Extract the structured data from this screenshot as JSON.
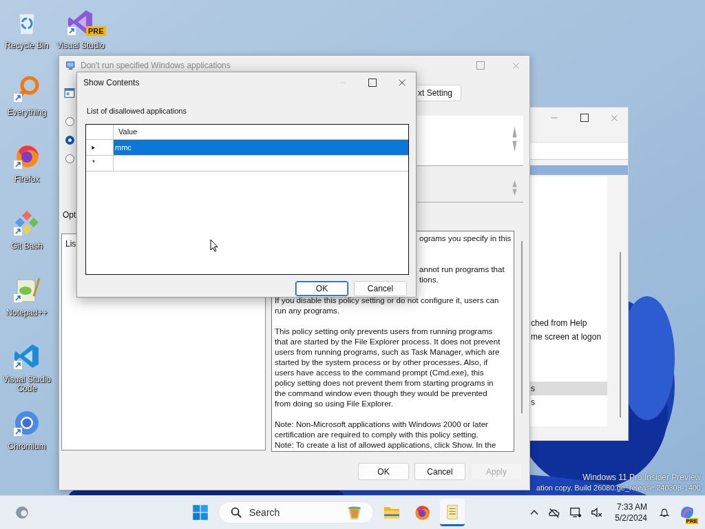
{
  "desktop_icons": [
    {
      "kind": "recycle",
      "label": "Recycle Bin",
      "shortcut": false
    },
    {
      "kind": "everything",
      "label": "Everything",
      "shortcut": true
    },
    {
      "kind": "firefox",
      "label": "Firefox",
      "shortcut": true
    },
    {
      "kind": "gitbash",
      "label": "Git Bash",
      "shortcut": true
    },
    {
      "kind": "notepadpp",
      "label": "Notepad++",
      "shortcut": true
    },
    {
      "kind": "vscode",
      "label": "Visual Studio Code",
      "shortcut": true
    },
    {
      "kind": "chromium",
      "label": "Chromium",
      "shortcut": true
    }
  ],
  "desktop_icon_2": {
    "kind": "vs",
    "label": "Visual Studio",
    "badge": "PRE",
    "shortcut": true
  },
  "back_window": {
    "items": [
      {
        "text": "ched from Help",
        "selected": false
      },
      {
        "text": "me screen at logon",
        "selected": false
      },
      {
        "text": "s",
        "selected": true
      },
      {
        "text": "s",
        "selected": false
      }
    ]
  },
  "policy_window": {
    "title": "Don't run specified Windows applications",
    "next_button": "xt Setting",
    "radios": [
      {
        "selected": false
      },
      {
        "selected": true
      },
      {
        "selected": false
      }
    ],
    "options_label": "Opt",
    "list_label": "Lis",
    "help": [
      {
        "kind": "covered",
        "lines": [
          "ograms you specify in this"
        ]
      },
      {
        "kind": "covered",
        "lines": [
          "annot run programs that",
          "tions."
        ]
      },
      {
        "kind": "text",
        "lines": [
          "If you disable this policy setting or do not configure it, users can",
          "run any programs."
        ]
      },
      {
        "kind": "text",
        "lines": [
          "This policy setting only prevents users from running programs",
          "that are started by the File Explorer process. It does not prevent",
          "users from running programs, such as Task Manager, which are",
          "started by the system process or by other processes.  Also, if",
          "users have access to the command prompt (Cmd.exe), this",
          "policy setting does not prevent them from starting programs in",
          "the command window even though they would be prevented",
          "from doing so using File Explorer."
        ]
      },
      {
        "kind": "text",
        "lines": [
          "Note: Non-Microsoft applications with Windows 2000 or later",
          "certification are required to comply with this policy setting.",
          "Note: To create a list of allowed applications, click Show.  In the"
        ]
      }
    ],
    "buttons": [
      {
        "label": "OK",
        "disabled": false
      },
      {
        "label": "Cancel",
        "disabled": false
      },
      {
        "label": "Apply",
        "disabled": true
      }
    ]
  },
  "dialog": {
    "title": "Show Contents",
    "label": "List of disallowed applications",
    "column": "Value",
    "rows": [
      {
        "kind": "current",
        "value": "mmc",
        "selected": true
      },
      {
        "kind": "new",
        "marker": "*",
        "selected": false
      }
    ],
    "buttons": [
      {
        "label": "OK",
        "default": true
      },
      {
        "label": "Cancel",
        "default": false
      }
    ]
  },
  "watermark": [
    "Windows 11 Pro Insider Preview",
    "ation copy. Build 26080.ge_release.240308-1400"
  ],
  "taskbar": {
    "search": {
      "placeholder": "Search"
    },
    "apps": [
      {
        "kind": "explorer",
        "active": false
      },
      {
        "kind": "firefox",
        "active": false
      },
      {
        "kind": "notepad",
        "active": true
      }
    ],
    "time": "7:33 AM",
    "date": "5/2/2024",
    "copilot_badge": "PRE"
  }
}
